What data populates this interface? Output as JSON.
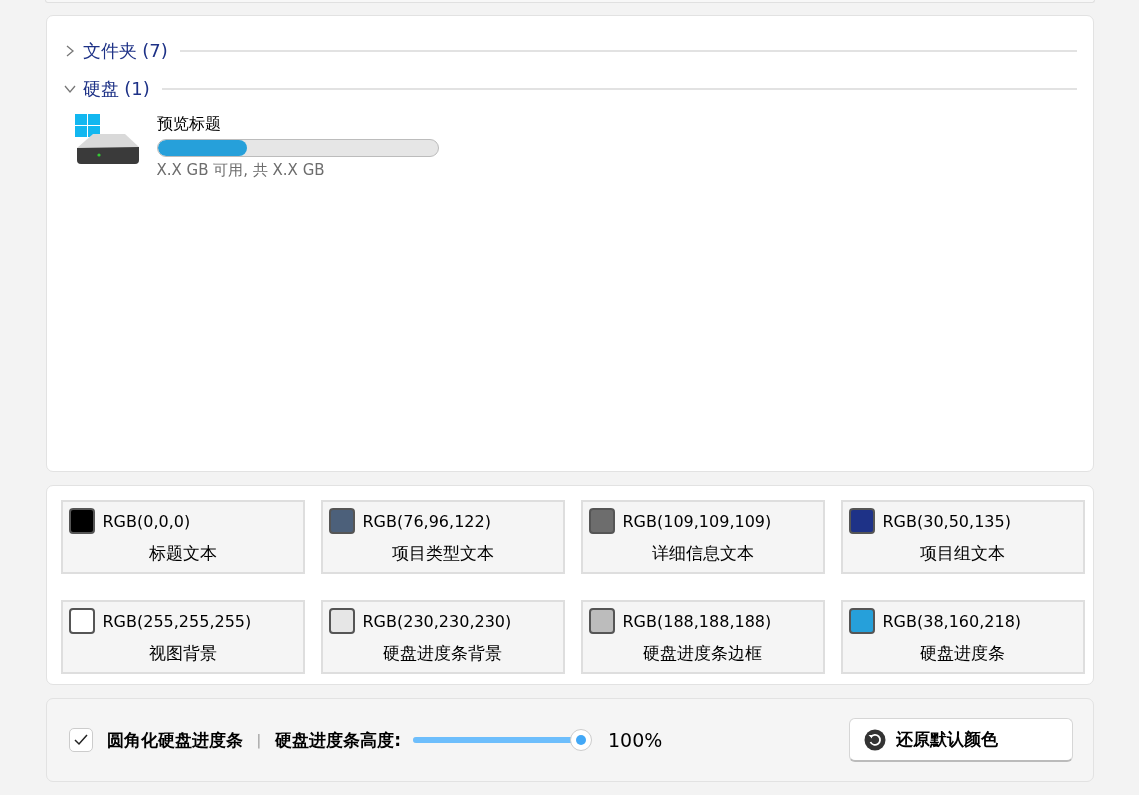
{
  "groups": [
    {
      "title": "文件夹 (7)",
      "expanded": false
    },
    {
      "title": "硬盘 (1)",
      "expanded": true,
      "items": [
        {
          "title": "预览标题",
          "level": 0.32,
          "detail": "X.X GB 可用, 共 X.X GB"
        }
      ]
    }
  ],
  "colors": [
    {
      "value": "RGB(0,0,0)",
      "label": "标题文本",
      "color": "#000000"
    },
    {
      "value": "RGB(76,96,122)",
      "label": "项目类型文本",
      "color": "#4c607a"
    },
    {
      "value": "RGB(109,109,109)",
      "label": "详细信息文本",
      "color": "#6d6d6d"
    },
    {
      "value": "RGB(30,50,135)",
      "label": "项目组文本",
      "color": "#1e3287"
    },
    {
      "value": "RGB(255,255,255)",
      "label": "视图背景",
      "color": "#ffffff"
    },
    {
      "value": "RGB(230,230,230)",
      "label": "硬盘进度条背景",
      "color": "#e6e6e6"
    },
    {
      "value": "RGB(188,188,188)",
      "label": "硬盘进度条边框",
      "color": "#bcbcbc"
    },
    {
      "value": "RGB(38,160,218)",
      "label": "硬盘进度条",
      "color": "#26a0da"
    }
  ],
  "options": {
    "rounded": {
      "label": "圆角化硬盘进度条",
      "checked": true
    },
    "separator": "|",
    "height": {
      "label": "硬盘进度条高度:",
      "level": 1,
      "reading": "100%"
    },
    "reset_button": "还原默认颜色"
  }
}
